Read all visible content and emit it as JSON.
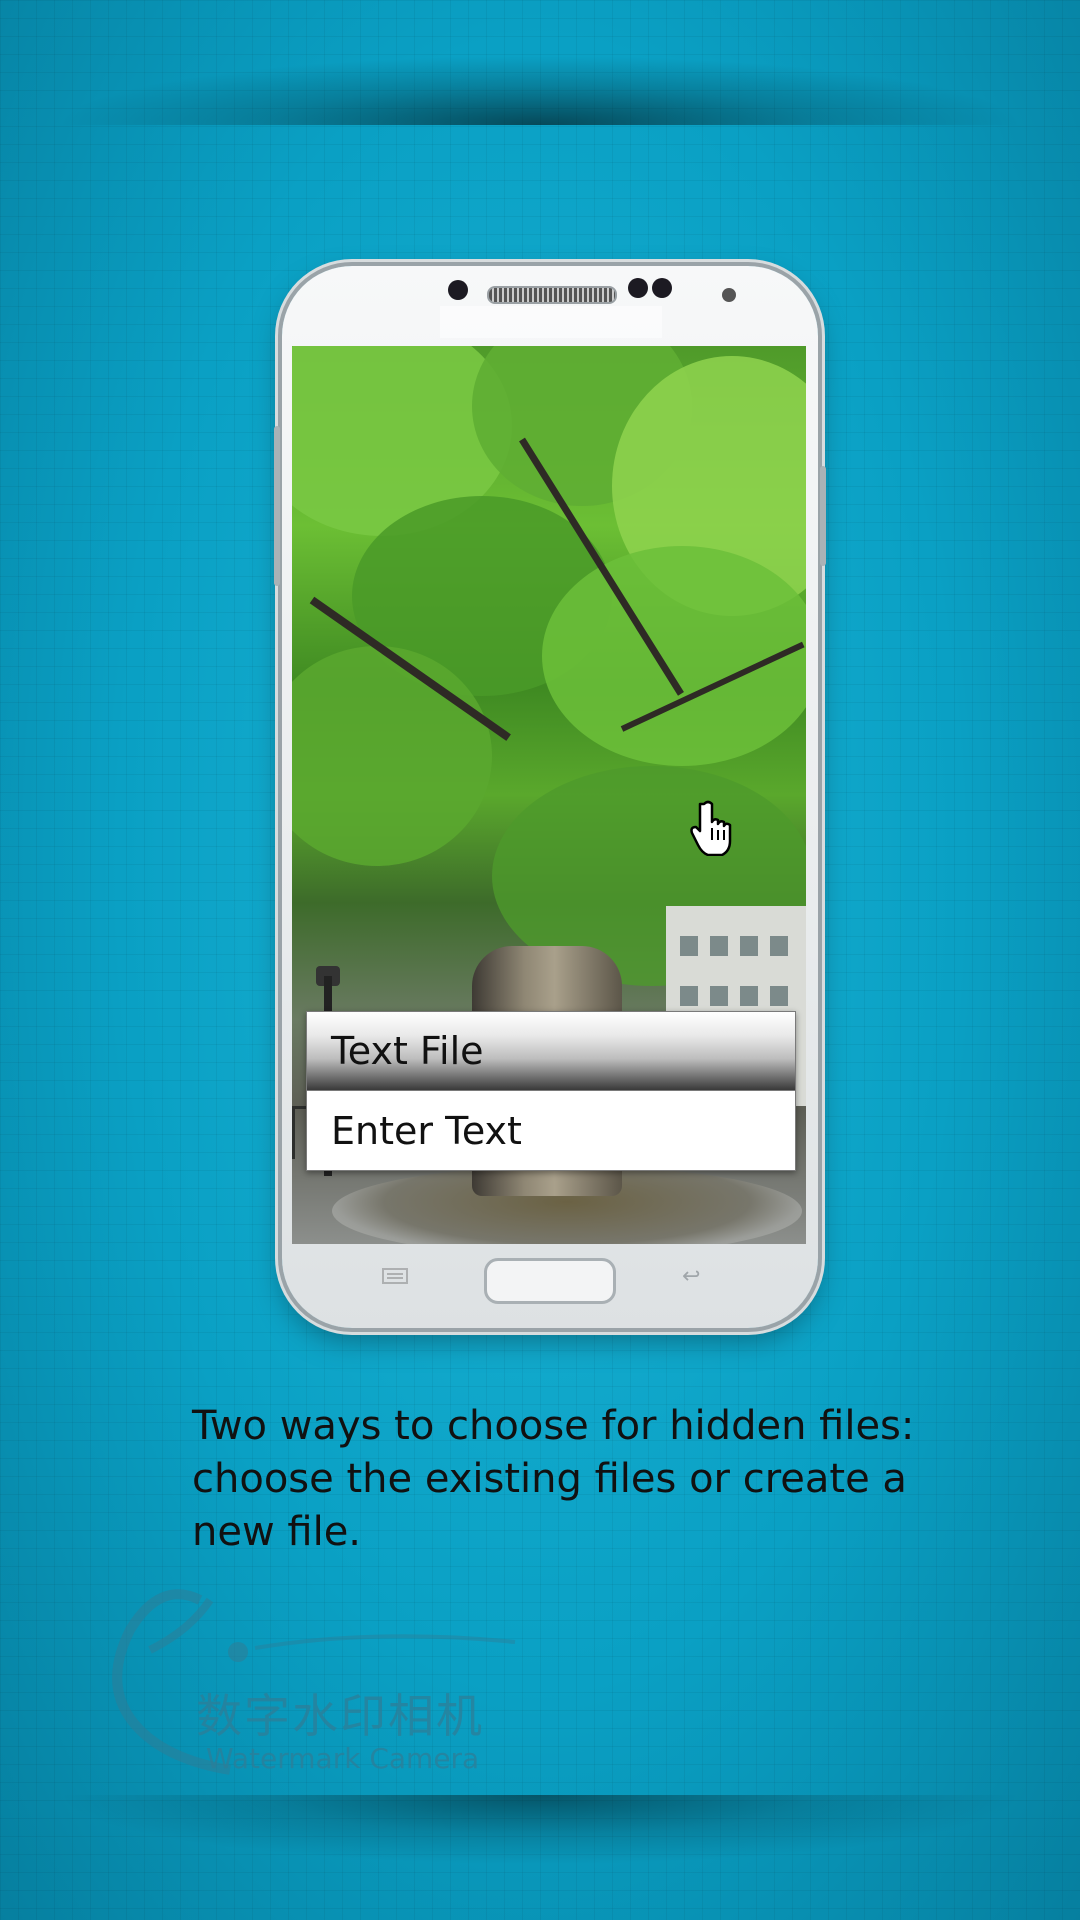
{
  "menu": {
    "items": [
      {
        "label": "Text File",
        "selected": true
      },
      {
        "label": "Enter Text",
        "selected": false
      }
    ]
  },
  "caption": "Two ways to choose for hidden files: choose the existing files or create a new file.",
  "logo": {
    "mark": "e.",
    "chinese": "数字水印相机",
    "english": "Watermark Camera"
  },
  "colors": {
    "background": "#0aa0c4",
    "logo": "#2d7e98"
  },
  "icons": [
    "hand-pointer-icon",
    "menu-key-icon",
    "back-key-icon"
  ]
}
